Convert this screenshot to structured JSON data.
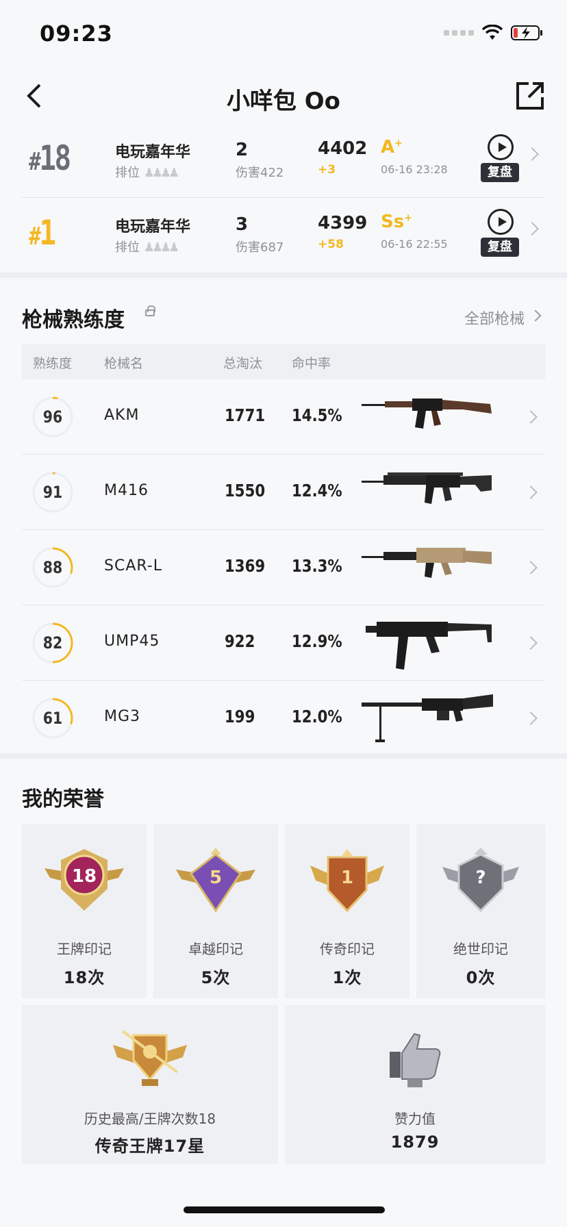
{
  "status_bar": {
    "time": "09:23"
  },
  "nav": {
    "title": "小咩包 Oo"
  },
  "matches": [
    {
      "rank_number": "18",
      "rank_color": "#6b6e75",
      "mode": "电玩嘉年华",
      "type": "排位",
      "kills": "2",
      "damage": "伤害422",
      "score": "4402",
      "delta": "+3",
      "grade": "A",
      "grade_sup": "+",
      "time": "06-16 23:28",
      "replay": "复盘"
    },
    {
      "rank_number": "1",
      "rank_color": "#f4b824",
      "mode": "电玩嘉年华",
      "type": "排位",
      "kills": "3",
      "damage": "伤害687",
      "score": "4399",
      "delta": "+58",
      "grade": "Ss",
      "grade_sup": "+",
      "time": "06-16 22:55",
      "replay": "复盘"
    }
  ],
  "weapons": {
    "title": "枪械熟练度",
    "all_label": "全部枪械",
    "headers": {
      "proficiency": "熟练度",
      "name": "枪械名",
      "kills": "总淘汰",
      "accuracy": "命中率"
    },
    "rows": [
      {
        "proficiency": "96",
        "progress": 0.04,
        "name": "AKM",
        "kills": "1771",
        "accuracy": "14.5%",
        "icon": "akm-rifle"
      },
      {
        "proficiency": "91",
        "progress": 0.02,
        "name": "M416",
        "kills": "1550",
        "accuracy": "12.4%",
        "icon": "m416-rifle"
      },
      {
        "proficiency": "88",
        "progress": 0.3,
        "name": "SCAR-L",
        "kills": "1369",
        "accuracy": "13.3%",
        "icon": "scar-l-rifle"
      },
      {
        "proficiency": "82",
        "progress": 0.5,
        "name": "UMP45",
        "kills": "922",
        "accuracy": "12.9%",
        "icon": "ump45-smg"
      },
      {
        "proficiency": "61",
        "progress": 0.3,
        "name": "MG3",
        "kills": "199",
        "accuracy": "12.0%",
        "icon": "mg3-machine-gun"
      }
    ]
  },
  "honors": {
    "title": "我的荣誉",
    "marks": [
      {
        "label": "王牌印记",
        "count": "18次",
        "badge_text": "18"
      },
      {
        "label": "卓越印记",
        "count": "5次",
        "badge_text": "5"
      },
      {
        "label": "传奇印记",
        "count": "1次",
        "badge_text": "1"
      },
      {
        "label": "绝世印记",
        "count": "0次",
        "badge_text": "?"
      }
    ],
    "highest": {
      "label": "历史最高/王牌次数18",
      "value": "传奇王牌17星"
    },
    "likes": {
      "label": "赞力值",
      "value": "1879"
    }
  },
  "colors": {
    "accent": "#f4b824",
    "grey_text": "#8e9097",
    "replay_bg": "#2d3036"
  }
}
